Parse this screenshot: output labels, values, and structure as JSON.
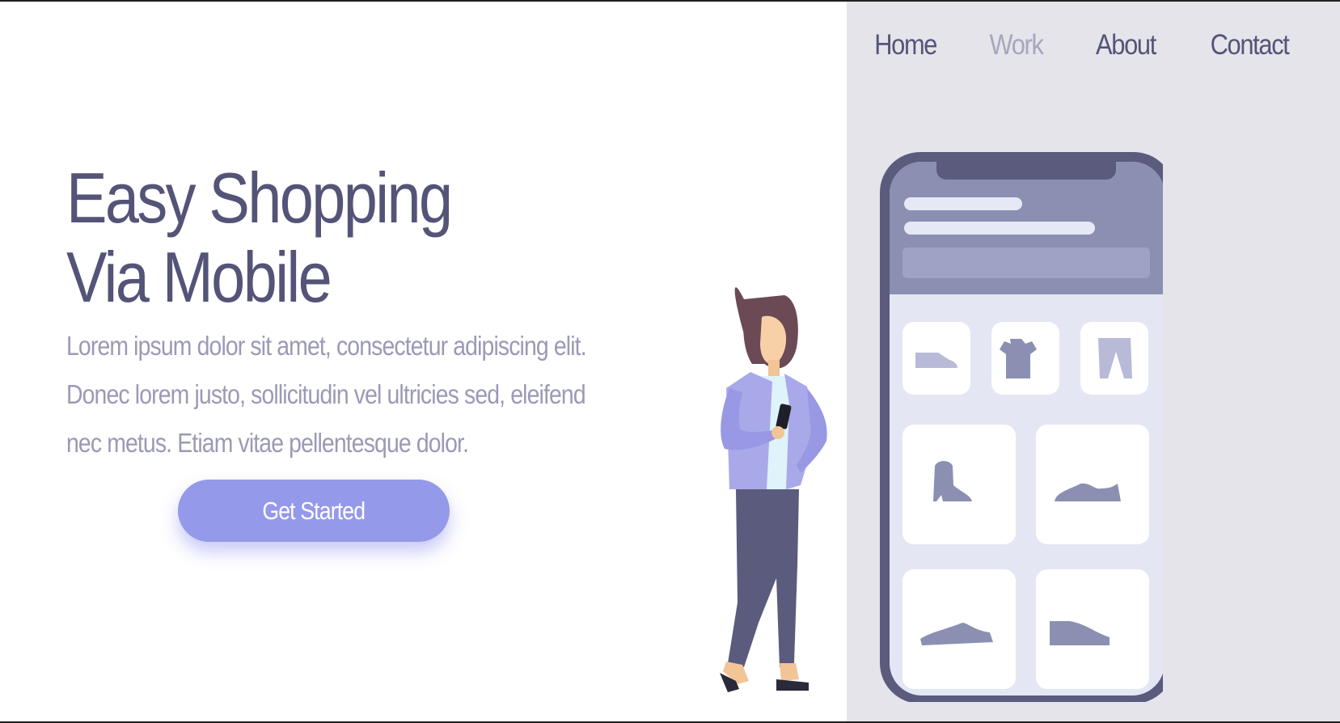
{
  "nav": {
    "items": [
      {
        "label": "Home"
      },
      {
        "label": "Work"
      },
      {
        "label": "About"
      },
      {
        "label": "Contact"
      }
    ]
  },
  "hero": {
    "title_line1": "Easy Shopping",
    "title_line2": "Via Mobile",
    "description": "Lorem ipsum dolor sit amet, consectetur adipiscing elit. Donec lorem justo, sollicitudin vel ultricies sed, eleifend nec metus. Etiam vitae pellentesque dolor.",
    "cta_label": "Get Started"
  },
  "colors": {
    "primary": "#545478",
    "muted": "#9a9ab6",
    "accent": "#9599e9",
    "panel": "#e4e4ea"
  },
  "illustration": {
    "icons": [
      "woman-holding-phone-icon",
      "shoe-icon",
      "tshirt-icon",
      "pants-icon",
      "boot-icon",
      "sneaker-icon"
    ]
  }
}
